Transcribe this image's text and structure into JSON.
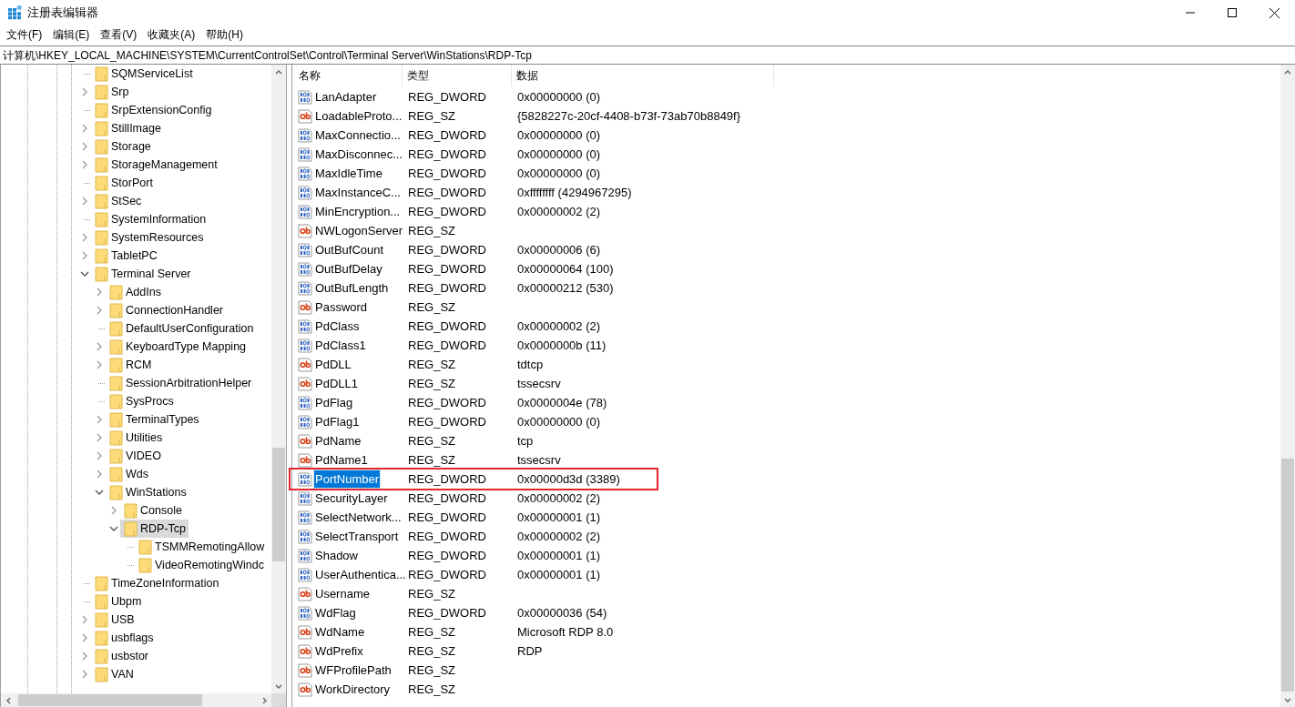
{
  "window": {
    "title": "注册表编辑器"
  },
  "menu": [
    "文件(F)",
    "编辑(E)",
    "查看(V)",
    "收藏夹(A)",
    "帮助(H)"
  ],
  "address_bar": {
    "value": "计算机\\HKEY_LOCAL_MACHINE\\SYSTEM\\CurrentControlSet\\Control\\Terminal Server\\WinStations\\RDP-Tcp"
  },
  "tree": [
    {
      "label": "SQMServiceList",
      "selected": false
    },
    {
      "label": "Srp",
      "expanded": false,
      "selected": false
    },
    {
      "label": "SrpExtensionConfig",
      "selected": false
    },
    {
      "label": "StillImage",
      "expanded": false,
      "selected": false
    },
    {
      "label": "Storage",
      "expanded": false,
      "selected": false
    },
    {
      "label": "StorageManagement",
      "expanded": false,
      "selected": false
    },
    {
      "label": "StorPort",
      "selected": false
    },
    {
      "label": "StSec",
      "expanded": false,
      "selected": false
    },
    {
      "label": "SystemInformation",
      "selected": false
    },
    {
      "label": "SystemResources",
      "expanded": false,
      "selected": false
    },
    {
      "label": "TabletPC",
      "expanded": false,
      "selected": false
    },
    {
      "label": "Terminal Server",
      "expanded": true,
      "selected": false,
      "children": [
        {
          "label": "AddIns",
          "expanded": false,
          "selected": false
        },
        {
          "label": "ConnectionHandler",
          "expanded": false,
          "selected": false
        },
        {
          "label": "DefaultUserConfiguration",
          "selected": false
        },
        {
          "label": "KeyboardType Mapping",
          "expanded": false,
          "selected": false
        },
        {
          "label": "RCM",
          "expanded": false,
          "selected": false
        },
        {
          "label": "SessionArbitrationHelper",
          "selected": false
        },
        {
          "label": "SysProcs",
          "selected": false
        },
        {
          "label": "TerminalTypes",
          "expanded": false,
          "selected": false
        },
        {
          "label": "Utilities",
          "expanded": false,
          "selected": false
        },
        {
          "label": "VIDEO",
          "expanded": false,
          "selected": false
        },
        {
          "label": "Wds",
          "expanded": false,
          "selected": false
        },
        {
          "label": "WinStations",
          "expanded": true,
          "selected": false,
          "children": [
            {
              "label": "Console",
              "expanded": false,
              "selected": false
            },
            {
              "label": "RDP-Tcp",
              "expanded": true,
              "selected": true,
              "children": [
                {
                  "label": "TSMMRemotingAllow",
                  "selected": false
                },
                {
                  "label": "VideoRemotingWindc",
                  "selected": false
                }
              ]
            }
          ]
        }
      ]
    },
    {
      "label": "TimeZoneInformation",
      "selected": false
    },
    {
      "label": "Ubpm",
      "selected": false
    },
    {
      "label": "USB",
      "expanded": false,
      "selected": false
    },
    {
      "label": "usbflags",
      "expanded": false,
      "selected": false
    },
    {
      "label": "usbstor",
      "expanded": false,
      "selected": false
    },
    {
      "label": "VAN",
      "expanded": false,
      "selected": false
    }
  ],
  "values": {
    "columns": [
      "名称",
      "类型",
      "数据"
    ],
    "rows": [
      {
        "kind": "dword",
        "name": "LanAdapter",
        "type": "REG_DWORD",
        "data": "0x00000000 (0)",
        "selected": false,
        "marked": false
      },
      {
        "kind": "sz",
        "name": "LoadableProto...",
        "type": "REG_SZ",
        "data": "{5828227c-20cf-4408-b73f-73ab70b8849f}",
        "selected": false,
        "marked": false
      },
      {
        "kind": "dword",
        "name": "MaxConnectio...",
        "type": "REG_DWORD",
        "data": "0x00000000 (0)",
        "selected": false,
        "marked": false
      },
      {
        "kind": "dword",
        "name": "MaxDisconnec...",
        "type": "REG_DWORD",
        "data": "0x00000000 (0)",
        "selected": false,
        "marked": false
      },
      {
        "kind": "dword",
        "name": "MaxIdleTime",
        "type": "REG_DWORD",
        "data": "0x00000000 (0)",
        "selected": false,
        "marked": false
      },
      {
        "kind": "dword",
        "name": "MaxInstanceC...",
        "type": "REG_DWORD",
        "data": "0xffffffff (4294967295)",
        "selected": false,
        "marked": false
      },
      {
        "kind": "dword",
        "name": "MinEncryption...",
        "type": "REG_DWORD",
        "data": "0x00000002 (2)",
        "selected": false,
        "marked": false
      },
      {
        "kind": "sz",
        "name": "NWLogonServer",
        "type": "REG_SZ",
        "selected": false,
        "marked": false
      },
      {
        "kind": "dword",
        "name": "OutBufCount",
        "type": "REG_DWORD",
        "data": "0x00000006 (6)",
        "selected": false,
        "marked": false
      },
      {
        "kind": "dword",
        "name": "OutBufDelay",
        "type": "REG_DWORD",
        "data": "0x00000064 (100)",
        "selected": false,
        "marked": false
      },
      {
        "kind": "dword",
        "name": "OutBufLength",
        "type": "REG_DWORD",
        "data": "0x00000212 (530)",
        "selected": false,
        "marked": false
      },
      {
        "kind": "sz",
        "name": "Password",
        "type": "REG_SZ",
        "selected": false,
        "marked": false
      },
      {
        "kind": "dword",
        "name": "PdClass",
        "type": "REG_DWORD",
        "data": "0x00000002 (2)",
        "selected": false,
        "marked": false
      },
      {
        "kind": "dword",
        "name": "PdClass1",
        "type": "REG_DWORD",
        "data": "0x0000000b (11)",
        "selected": false,
        "marked": false
      },
      {
        "kind": "sz",
        "name": "PdDLL",
        "type": "REG_SZ",
        "data": "tdtcp",
        "selected": false,
        "marked": false
      },
      {
        "kind": "sz",
        "name": "PdDLL1",
        "type": "REG_SZ",
        "data": "tssecsrv",
        "selected": false,
        "marked": false
      },
      {
        "kind": "dword",
        "name": "PdFlag",
        "type": "REG_DWORD",
        "data": "0x0000004e (78)",
        "selected": false,
        "marked": false
      },
      {
        "kind": "dword",
        "name": "PdFlag1",
        "type": "REG_DWORD",
        "data": "0x00000000 (0)",
        "selected": false,
        "marked": false
      },
      {
        "kind": "sz",
        "name": "PdName",
        "type": "REG_SZ",
        "data": "tcp",
        "selected": false,
        "marked": false
      },
      {
        "kind": "sz",
        "name": "PdName1",
        "type": "REG_SZ",
        "data": "tssecsrv",
        "selected": false,
        "marked": false
      },
      {
        "kind": "dword",
        "name": "PortNumber",
        "type": "REG_DWORD",
        "data": "0x00000d3d (3389)",
        "selected": true,
        "marked": true
      },
      {
        "kind": "dword",
        "name": "SecurityLayer",
        "type": "REG_DWORD",
        "data": "0x00000002 (2)",
        "selected": false,
        "marked": false
      },
      {
        "kind": "dword",
        "name": "SelectNetwork...",
        "type": "REG_DWORD",
        "data": "0x00000001 (1)",
        "selected": false,
        "marked": false
      },
      {
        "kind": "dword",
        "name": "SelectTransport",
        "type": "REG_DWORD",
        "data": "0x00000002 (2)",
        "selected": false,
        "marked": false
      },
      {
        "kind": "dword",
        "name": "Shadow",
        "type": "REG_DWORD",
        "data": "0x00000001 (1)",
        "selected": false,
        "marked": false
      },
      {
        "kind": "dword",
        "name": "UserAuthentica...",
        "type": "REG_DWORD",
        "data": "0x00000001 (1)",
        "selected": false,
        "marked": false
      },
      {
        "kind": "sz",
        "name": "Username",
        "type": "REG_SZ",
        "selected": false,
        "marked": false
      },
      {
        "kind": "dword",
        "name": "WdFlag",
        "type": "REG_DWORD",
        "data": "0x00000036 (54)",
        "selected": false,
        "marked": false
      },
      {
        "kind": "sz",
        "name": "WdName",
        "type": "REG_SZ",
        "data": "Microsoft RDP 8.0",
        "selected": false,
        "marked": false
      },
      {
        "kind": "sz",
        "name": "WdPrefix",
        "type": "REG_SZ",
        "data": "RDP",
        "selected": false,
        "marked": false
      },
      {
        "kind": "sz",
        "name": "WFProfilePath",
        "type": "REG_SZ",
        "selected": false,
        "marked": false
      },
      {
        "kind": "sz",
        "name": "WorkDirectory",
        "type": "REG_SZ",
        "selected": false,
        "marked": false
      }
    ]
  }
}
